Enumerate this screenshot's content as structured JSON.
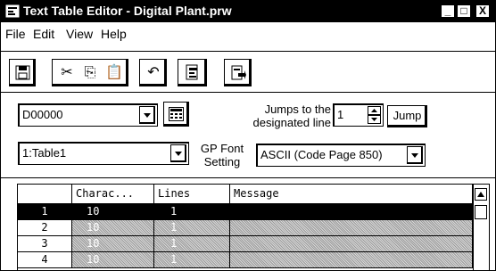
{
  "window": {
    "title": "Text Table Editor - Digital Plant.prw",
    "caption_buttons": [
      "_",
      "□",
      "X"
    ]
  },
  "menu": [
    "File",
    "Edit",
    "View",
    "Help"
  ],
  "toolbar": {
    "icons": [
      "save-icon",
      "cut-icon",
      "copy-icon",
      "paste-icon",
      "undo-icon",
      "import-icon",
      "export-icon"
    ]
  },
  "address": {
    "value": "D00000"
  },
  "jump": {
    "label_line1": "Jumps to the",
    "label_line2": "designated line",
    "value": "1",
    "button": "Jump"
  },
  "table_select": {
    "value": "1:Table1"
  },
  "font": {
    "label_line1": "GP Font",
    "label_line2": "Setting",
    "value": "ASCII (Code Page 850)"
  },
  "grid": {
    "columns": [
      "",
      "Charac...",
      "Lines",
      "Message"
    ],
    "rows": [
      {
        "num": "1",
        "chars": "10",
        "lines": "1",
        "message": ""
      },
      {
        "num": "2",
        "chars": "10",
        "lines": "1",
        "message": ""
      },
      {
        "num": "3",
        "chars": "10",
        "lines": "1",
        "message": ""
      },
      {
        "num": "4",
        "chars": "10",
        "lines": "1",
        "message": ""
      }
    ]
  }
}
